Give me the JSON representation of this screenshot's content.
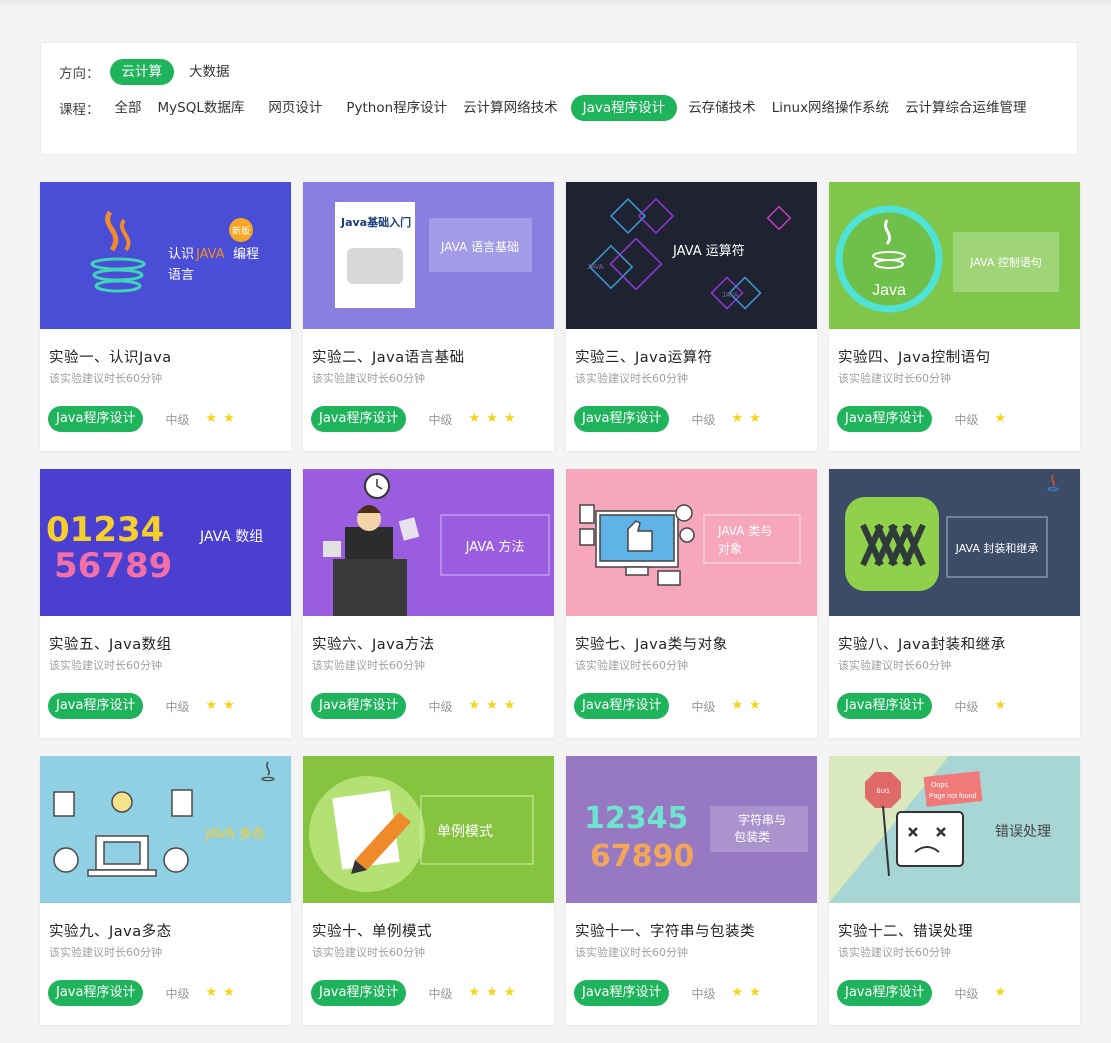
{
  "filters": {
    "direction_label": "方向：",
    "directions": [
      {
        "label": "云计算",
        "active": true
      },
      {
        "label": "大数据",
        "active": false
      }
    ],
    "course_label": "课程：",
    "courses": [
      {
        "label": "全部",
        "active": false
      },
      {
        "label": "MySQL数据库",
        "active": false
      },
      {
        "label": "网页设计",
        "active": false
      },
      {
        "label": "Python程序设计",
        "active": false
      },
      {
        "label": "云计算网络技术",
        "active": false
      },
      {
        "label": "Java程序设计",
        "active": true
      },
      {
        "label": "云存储技术",
        "active": false
      },
      {
        "label": "Linux网络操作系统",
        "active": false
      },
      {
        "label": "云计算综合运维管理",
        "active": false
      }
    ]
  },
  "colors": {
    "accent": "#1fb35c",
    "star": "#f7d31a"
  },
  "cards": [
    {
      "title": "实验一、认识Java",
      "desc": "该实验建议时长60分钟",
      "tag": "Java程序设计",
      "level": "中级",
      "stars": 2,
      "thumb": {
        "bg": "#4a4ed6",
        "text_a": "认识",
        "text_b": "JAVA",
        "text_c": "编程",
        "text_d": "语言",
        "badge": "新版",
        "icon": "java-cup-icon"
      }
    },
    {
      "title": "实验二、Java语言基础",
      "desc": "该实验建议时长60分钟",
      "tag": "Java程序设计",
      "level": "中级",
      "stars": 3,
      "thumb": {
        "bg": "#8a7fe0",
        "text": "JAVA 语言基础",
        "book": "Java基础入门",
        "icon": "book-icon"
      }
    },
    {
      "title": "实验三、Java运算符",
      "desc": "该实验建议时长60分钟",
      "tag": "Java程序设计",
      "level": "中级",
      "stars": 2,
      "thumb": {
        "bg": "#1f2230",
        "text": "JAVA 运算符",
        "small_a": "JAVA",
        "small_b": "JAVA",
        "icon": "operator-icon"
      }
    },
    {
      "title": "实验四、Java控制语句",
      "desc": "该实验建议时长60分钟",
      "tag": "Java程序设计",
      "level": "中级",
      "stars": 1,
      "thumb": {
        "bg": "#7fc64a",
        "text": "JAVA 控制语句",
        "logo": "Java",
        "icon": "java-logo-icon"
      }
    },
    {
      "title": "实验五、Java数组",
      "desc": "该实验建议时长60分钟",
      "tag": "Java程序设计",
      "level": "中级",
      "stars": 2,
      "thumb": {
        "bg": "#4a3fd0",
        "text": "JAVA 数组",
        "digits_a": "01234",
        "digits_b": "56789",
        "icon": "numbers-icon"
      }
    },
    {
      "title": "实验六、Java方法",
      "desc": "该实验建议时长60分钟",
      "tag": "Java程序设计",
      "level": "中级",
      "stars": 3,
      "thumb": {
        "bg": "#9b5de0",
        "text": "JAVA 方法",
        "icon": "busy-person-icon"
      }
    },
    {
      "title": "实验七、Java类与对象",
      "desc": "该实验建议时长60分钟",
      "tag": "Java程序设计",
      "level": "中级",
      "stars": 2,
      "thumb": {
        "bg": "#f6a7bb",
        "text_a": "JAVA 类与",
        "text_b": "对象",
        "icon": "computer-like-icon"
      }
    },
    {
      "title": "实验八、Java封装和继承",
      "desc": "该实验建议时长60分钟",
      "tag": "Java程序设计",
      "level": "中级",
      "stars": 1,
      "thumb": {
        "bg": "#3c4b66",
        "text": "JAVA 封装和继承",
        "icon": "package-icon"
      }
    },
    {
      "title": "实验九、Java多态",
      "desc": "该实验建议时长60分钟",
      "tag": "Java程序设计",
      "level": "中级",
      "stars": 2,
      "thumb": {
        "bg": "#8fd0e4",
        "text": "JAVA 多态",
        "icon": "network-laptop-icon"
      }
    },
    {
      "title": "实验十、单例模式",
      "desc": "该实验建议时长60分钟",
      "tag": "Java程序设计",
      "level": "中级",
      "stars": 3,
      "thumb": {
        "bg": "#86c43f",
        "text": "单例模式",
        "icon": "pencil-paper-icon"
      }
    },
    {
      "title": "实验十一、字符串与包装类",
      "desc": "该实验建议时长60分钟",
      "tag": "Java程序设计",
      "level": "中级",
      "stars": 2,
      "thumb": {
        "bg": "#9679c2",
        "text_a": "字符串与",
        "text_b": "包装类",
        "digits_a": "12345",
        "digits_b": "67890",
        "icon": "numbers-icon"
      }
    },
    {
      "title": "实验十二、错误处理",
      "desc": "该实验建议时长60分钟",
      "tag": "Java程序设计",
      "level": "中级",
      "stars": 1,
      "thumb": {
        "bg": "#a8d6d4",
        "text": "错误处理",
        "bug": "BUG",
        "oops_a": "Oops,",
        "oops_b": "Page not found",
        "icon": "error-window-icon"
      }
    }
  ]
}
